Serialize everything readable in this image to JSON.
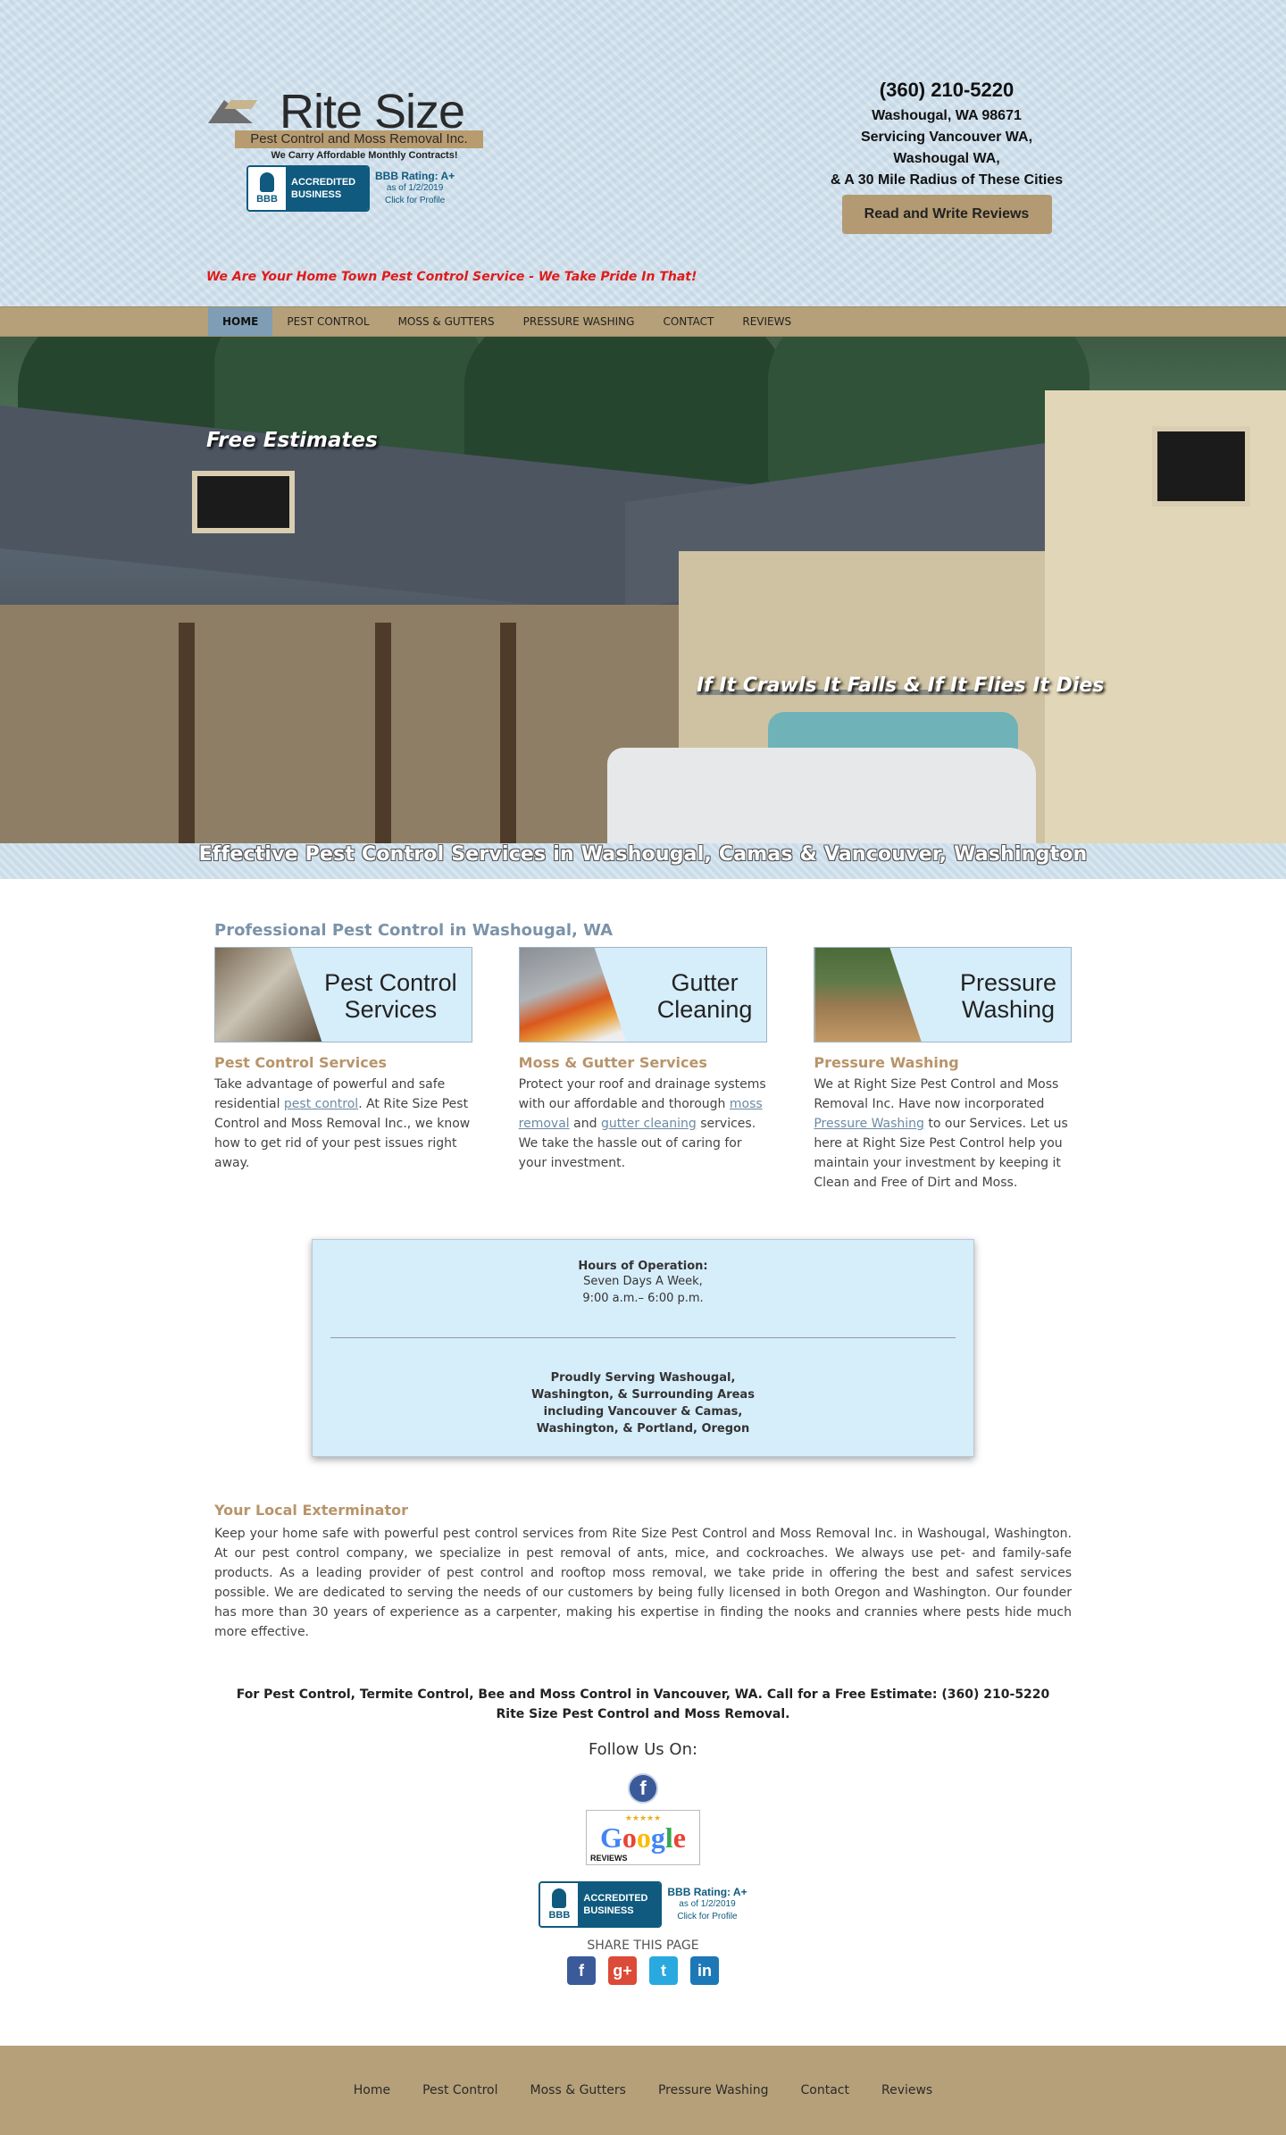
{
  "header": {
    "logo_title": "Rite Size",
    "logo_subtitle": "Pest Control and Moss Removal Inc.",
    "logo_tagline": "We Carry Affordable Monthly Contracts!",
    "phone": "(360) 210-5220",
    "address_lines": [
      "Washougal, WA 98671",
      "Servicing Vancouver WA,",
      "Washougal WA,",
      "& A 30 Mile Radius of These Cities"
    ],
    "reviews_button": "Read and Write Reviews",
    "hometown": "We Are Your Home Town Pest Control Service - We Take Pride In That!"
  },
  "bbb": {
    "seal": "BBB",
    "accredited_line1": "ACCREDITED",
    "accredited_line2": "BUSINESS",
    "rating": "BBB Rating: A+",
    "as_of": "as of 1/2/2019",
    "click": "Click for Profile"
  },
  "nav": {
    "items": [
      "HOME",
      "PEST CONTROL",
      "MOSS & GUTTERS",
      "PRESSURE WASHING",
      "CONTACT",
      "REVIEWS"
    ],
    "active": "HOME"
  },
  "hero": {
    "text1": "Free Estimates",
    "text2": "If It Crawls It Falls & If It Flies It Dies",
    "strip": "Effective Pest Control Services in Washougal, Camas & Vancouver, Washington"
  },
  "main": {
    "section_title": "Professional Pest Control in Washougal, WA",
    "services": [
      {
        "banner_line1": "Pest Control",
        "banner_line2": "Services",
        "heading": "Pest Control Services",
        "text_a": "Take advantage of powerful and safe residential ",
        "link1": "pest control",
        "text_b": ". At Rite Size Pest Control and Moss Removal Inc., we know how to get rid of your pest issues right away.",
        "link2": "",
        "text_c": ""
      },
      {
        "banner_line1": "Gutter",
        "banner_line2": "Cleaning",
        "heading": "Moss & Gutter Services",
        "text_a": "Protect your roof and drainage systems with our affordable and thorough ",
        "link1": "moss removal",
        "text_b": " and ",
        "link2": "gutter cleaning",
        "text_c": " services. We take the hassle out of caring for your investment."
      },
      {
        "banner_line1": "Pressure",
        "banner_line2": "Washing",
        "heading": "Pressure Washing",
        "text_a": "We at Right Size Pest Control and Moss Removal Inc. Have now incorporated ",
        "link1": "Pressure Washing",
        "text_b": " to our Services. Let us here at Right Size Pest Control help you maintain your investment by keeping it Clean and Free of Dirt and Moss.",
        "link2": "",
        "text_c": ""
      }
    ],
    "hours": {
      "title": "Hours of Operation:",
      "line1": "Seven Days A Week,",
      "line2": "9:00 a.m.– 6:00 p.m.",
      "serving": [
        "Proudly Serving Washougal,",
        "Washington, & Surrounding Areas",
        "including Vancouver & Camas,",
        "Washington, & Portland, Oregon"
      ]
    },
    "local": {
      "title": "Your Local Exterminator",
      "text": "Keep your home safe with powerful pest control services from Rite Size Pest Control and Moss Removal Inc. in Washougal, Washington. At our pest control company, we specialize in pest removal of ants, mice, and cockroaches. We always use pet- and family-safe products. As a leading provider of pest control and rooftop moss removal, we take pride in offering the best and safest services possible. We are dedicated to serving the needs of our customers by being fully licensed in both Oregon and Washington. Our founder has more than 30 years of experience as a carpenter, making his expertise in finding the nooks and crannies where pests hide much more effective."
    },
    "cta": "For Pest Control, Termite Control, Bee and Moss Control in Vancouver, WA. Call for a Free Estimate: (360) 210-5220 Rite Size Pest Control and Moss Removal.",
    "follow": "Follow Us On:",
    "facebook_letter": "f",
    "google_reviews": {
      "stars": "★★★★★",
      "word": "Google",
      "label": "REVIEWS"
    },
    "share": "SHARE THIS PAGE",
    "share_icons": [
      {
        "name": "facebook",
        "glyph": "f",
        "color": "#3b5a9a"
      },
      {
        "name": "google-plus",
        "glyph": "g+",
        "color": "#dc4a38"
      },
      {
        "name": "twitter",
        "glyph": "t",
        "color": "#2aa9e0"
      },
      {
        "name": "linkedin",
        "glyph": "in",
        "color": "#1d78b7"
      }
    ]
  },
  "footer": {
    "links": [
      "Home",
      "Pest Control",
      "Moss & Gutters",
      "Pressure Washing",
      "Contact",
      "Reviews"
    ]
  },
  "colors": {
    "sky": "#cfe0ec",
    "tan": "#b6a079",
    "nav_active": "#7f9db4",
    "heading_blue": "#7b93a9",
    "heading_tan": "#b8946a",
    "alert_red": "#e01b1b",
    "bbb_blue": "#0f5a7e"
  }
}
